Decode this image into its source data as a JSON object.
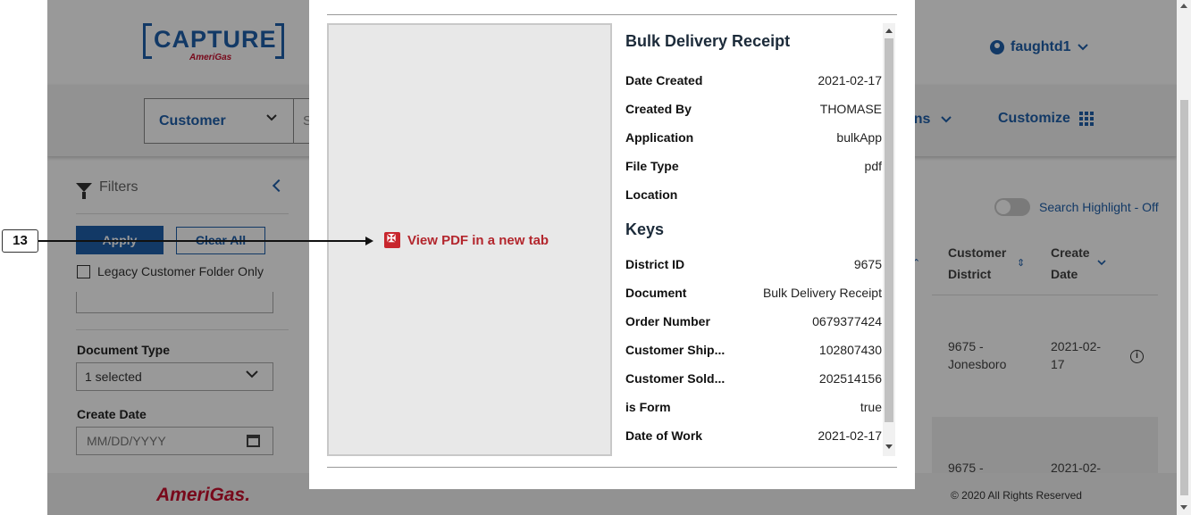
{
  "header": {
    "logo_word": "CAPTURE",
    "logo_sub": "AmeriGas",
    "user_name": "faughtd1"
  },
  "searchbar": {
    "search_type": "Customer",
    "search_placeholder": "S",
    "operations_label": "ons",
    "customize_label": "Customize"
  },
  "filters": {
    "title": "Filters",
    "apply_label": "Apply",
    "clear_label": "Clear All",
    "legacy_label": "Legacy Customer Folder Only",
    "document_type_label": "Document Type",
    "document_type_value": "1 selected",
    "create_date_label": "Create Date",
    "create_date_placeholder": "MM/DD/YYYY"
  },
  "results": {
    "highlight_label": "Search Highlight - Off",
    "columns": [
      {
        "label": "Customer District"
      },
      {
        "label": "Create Date"
      }
    ],
    "rows": [
      {
        "district": "9675 - Jonesboro",
        "date": "2021-02-17"
      },
      {
        "district": "9675 -",
        "date": "2021-02-"
      }
    ]
  },
  "footer": {
    "brand": "AmeriGas.",
    "copyright": "© 2020 All Rights Reserved"
  },
  "modal": {
    "view_pdf_label": "View PDF in a new tab",
    "title": "Bulk Delivery Receipt",
    "fields": [
      {
        "label": "Date Created",
        "value": "2021-02-17"
      },
      {
        "label": "Created By",
        "value": "THOMASE"
      },
      {
        "label": "Application",
        "value": "bulkApp"
      },
      {
        "label": "File Type",
        "value": "pdf"
      },
      {
        "label": "Location",
        "value": ""
      }
    ],
    "keys_title": "Keys",
    "keys": [
      {
        "label": "District ID",
        "value": "9675"
      },
      {
        "label": "Document",
        "value": "Bulk Delivery Receipt"
      },
      {
        "label": "Order Number",
        "value": "0679377424"
      },
      {
        "label": "Customer Ship...",
        "value": "102807430"
      },
      {
        "label": "Customer Sold...",
        "value": "202514156"
      },
      {
        "label": "is Form",
        "value": "true"
      },
      {
        "label": "Date of Work",
        "value": "2021-02-17"
      }
    ]
  },
  "annotation": {
    "number": "13"
  },
  "colors": {
    "brand_blue": "#1f5faa",
    "brand_red": "#c8102e",
    "pdf_red": "#b3262d",
    "overlay": "rgba(0,0,0,0.4)"
  }
}
